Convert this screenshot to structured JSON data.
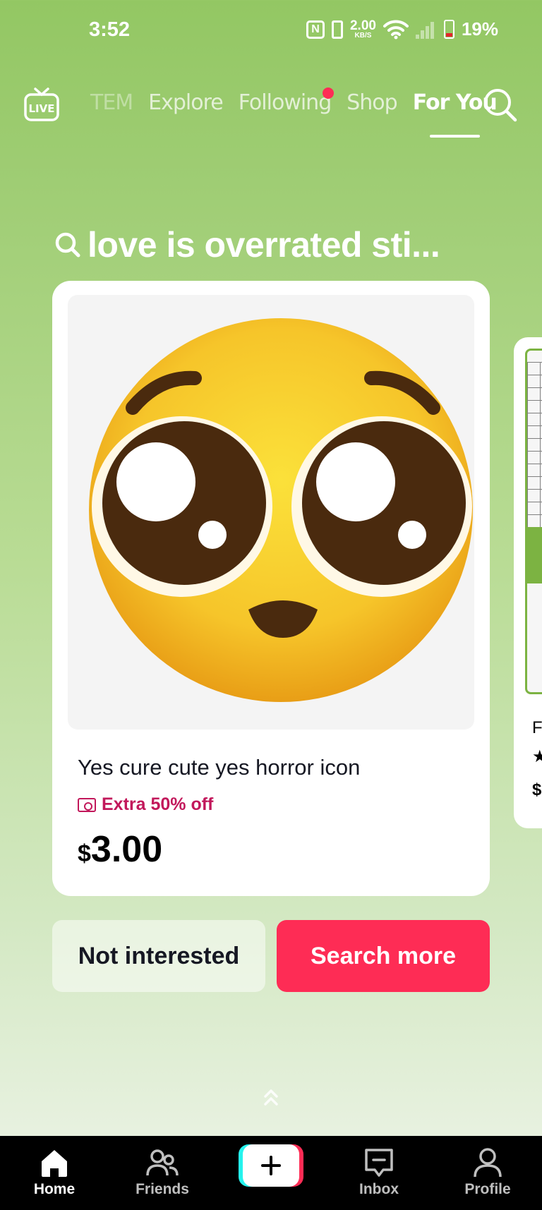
{
  "status_bar": {
    "time": "3:52",
    "speed_value": "2.00",
    "speed_unit": "KB/S",
    "battery": "19%",
    "icons": [
      "nfc-icon",
      "vibrate-icon",
      "wifi-icon",
      "signal-icon",
      "battery-icon"
    ]
  },
  "top_nav": {
    "live_label": "LIVE",
    "tabs": [
      "TEM",
      "Explore",
      "Following",
      "Shop",
      "For You"
    ],
    "active_tab": "For You",
    "following_has_notification": true
  },
  "query": {
    "text": "love is overrated sti..."
  },
  "product": {
    "image_icon": "pleading-face-emoji",
    "title": "Yes cure cute yes horror icon",
    "promo": "Extra 50% off",
    "price_currency": "$",
    "price_amount": "3.00"
  },
  "peek_card": {
    "text_line1": "F",
    "text_line3": "$"
  },
  "actions": {
    "not_interested": "Not interested",
    "search_more": "Search more"
  },
  "bottom_nav": {
    "home": "Home",
    "friends": "Friends",
    "inbox": "Inbox",
    "profile": "Profile",
    "active": "Home"
  },
  "colors": {
    "background_top": "#93c763",
    "accent_red": "#fe2c55",
    "accent_cyan": "#25f4ee",
    "promo_color": "#c2185b"
  }
}
